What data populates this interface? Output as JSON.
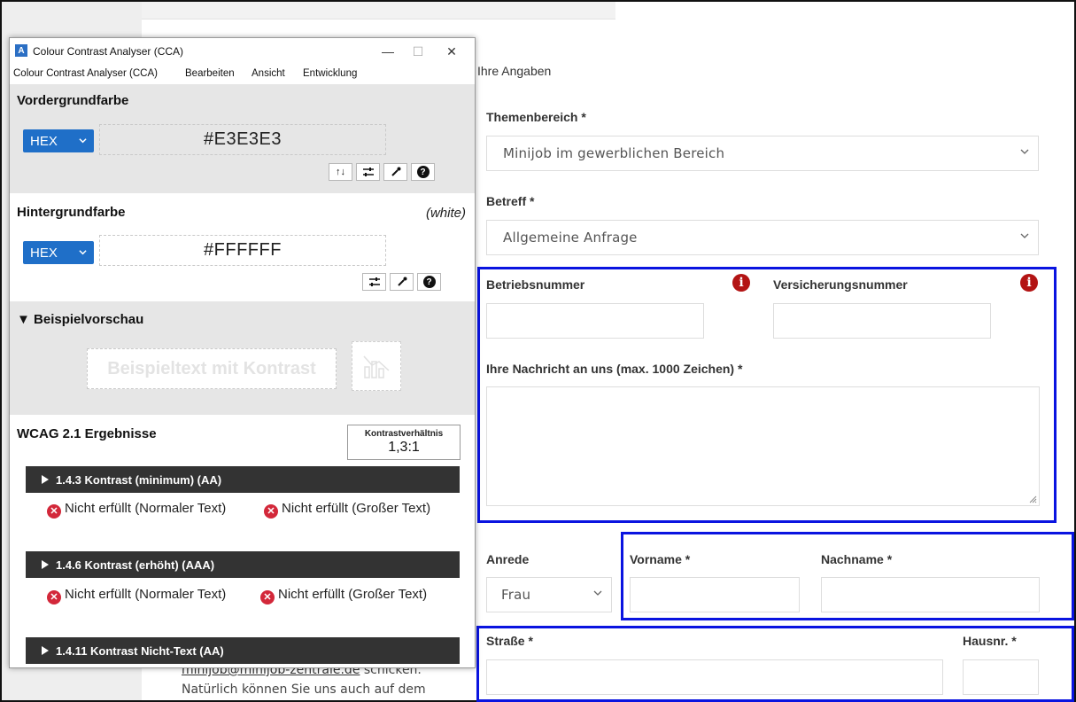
{
  "form": {
    "section_title": "Ihre Angaben",
    "themenbereich": {
      "label": "Themenbereich *",
      "value": "Minijob im gewerblichen Bereich"
    },
    "betreff": {
      "label": "Betreff *",
      "value": "Allgemeine Anfrage"
    },
    "betriebsnummer": {
      "label": "Betriebsnummer"
    },
    "versicherungsnummer": {
      "label": "Versicherungsnummer"
    },
    "nachricht": {
      "label": "Ihre Nachricht an uns (max. 1000 Zeichen) *"
    },
    "anrede": {
      "label": "Anrede",
      "value": "Frau"
    },
    "vorname": {
      "label": "Vorname *"
    },
    "nachname": {
      "label": "Nachname *"
    },
    "strasse": {
      "label": "Straße *"
    },
    "hausnr": {
      "label": "Hausnr. *"
    },
    "highlight_color": "#0a14e0",
    "info_color": "#b31414"
  },
  "page_text": {
    "email_link": "minijob@minijob-zentrale.de",
    "email_suffix": " schicken.",
    "line2": "Natürlich können Sie uns auch auf dem"
  },
  "cca": {
    "window_title": "Colour Contrast Analyser (CCA)",
    "window_controls": {
      "minimize": "—",
      "maximize": "☐",
      "close": "✕"
    },
    "menu": [
      "Colour Contrast Analyser (CCA)",
      "Bearbeiten",
      "Ansicht",
      "Entwicklung"
    ],
    "foreground": {
      "title": "Vordergrundfarbe",
      "format": "HEX",
      "value": "#E3E3E3",
      "color": "#E3E3E3"
    },
    "background": {
      "title": "Hintergrundfarbe",
      "note": "(white)",
      "format": "HEX",
      "value": "#FFFFFF",
      "color": "#FFFFFF"
    },
    "preview": {
      "title": "▼ Beispielvorschau",
      "sample_text": "Beispieltext mit Kontrast"
    },
    "wcag": {
      "title": "WCAG 2.1 Ergebnisse",
      "ratio_label": "Kontrastverhältnis",
      "ratio_value": "1,3:1",
      "criteria": [
        {
          "name": "1.4.3 Kontrast (minimum) (AA)",
          "normal": "Nicht erfüllt (Normaler Text)",
          "large": "Nicht erfüllt (Großer Text)"
        },
        {
          "name": "1.4.6 Kontrast (erhöht) (AAA)",
          "normal": "Nicht erfüllt (Normaler Text)",
          "large": "Nicht erfüllt (Großer Text)"
        },
        {
          "name": "1.4.11 Kontrast Nicht-Text (AA)"
        }
      ]
    },
    "accent_color": "#1f6fc8",
    "fail_color": "#d3283a"
  }
}
